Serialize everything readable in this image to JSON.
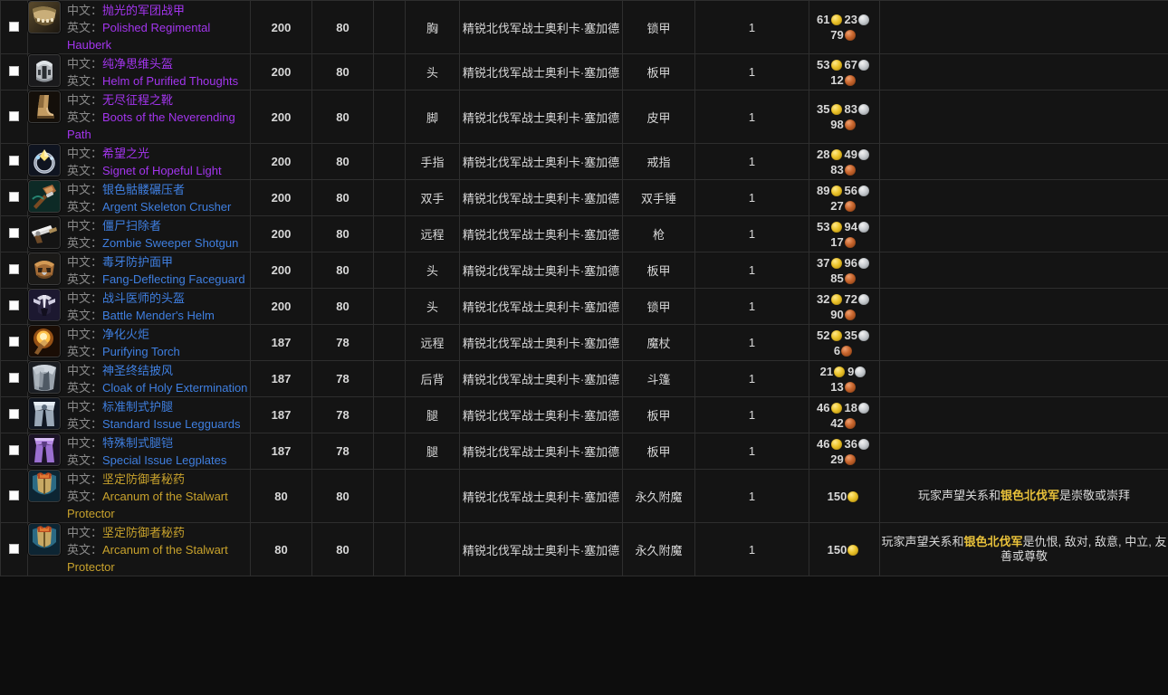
{
  "labels": {
    "cn_prefix": "中文：",
    "en_prefix": "英文："
  },
  "colors": {
    "epic": "#a335ee",
    "rare": "#3f7fe0",
    "uncommon": "#c8a22c",
    "faction_highlight": "#e8c13a",
    "background": "#141414",
    "border": "#2e2e2e"
  },
  "rows": [
    {
      "icon": "hauberk-icon",
      "quality": "epic",
      "name_cn": "抛光的军团战甲",
      "name_en": "Polished Regimental Hauberk",
      "ilvl": "200",
      "req_level": "80",
      "blank": "",
      "slot": "胸",
      "source": "精锐北伐军战士奥利卡·塞加德",
      "type": "锁甲",
      "qty": "1",
      "price": {
        "gold": "61",
        "silver": "23",
        "copper": "79"
      },
      "note": "",
      "note_faction": ""
    },
    {
      "icon": "helm-icon",
      "quality": "epic",
      "name_cn": "纯净思维头盔",
      "name_en": "Helm of Purified Thoughts",
      "ilvl": "200",
      "req_level": "80",
      "blank": "",
      "slot": "头",
      "source": "精锐北伐军战士奥利卡·塞加德",
      "type": "板甲",
      "qty": "1",
      "price": {
        "gold": "53",
        "silver": "67",
        "copper": "12"
      },
      "note": "",
      "note_faction": ""
    },
    {
      "icon": "boots-icon",
      "quality": "epic",
      "name_cn": "无尽征程之靴",
      "name_en": "Boots of the Neverending Path",
      "ilvl": "200",
      "req_level": "80",
      "blank": "",
      "slot": "脚",
      "source": "精锐北伐军战士奥利卡·塞加德",
      "type": "皮甲",
      "qty": "1",
      "price": {
        "gold": "35",
        "silver": "83",
        "copper": "98"
      },
      "note": "",
      "note_faction": ""
    },
    {
      "icon": "ring-icon",
      "quality": "epic",
      "name_cn": "希望之光",
      "name_en": "Signet of Hopeful Light",
      "ilvl": "200",
      "req_level": "80",
      "blank": "",
      "slot": "手指",
      "source": "精锐北伐军战士奥利卡·塞加德",
      "type": "戒指",
      "qty": "1",
      "price": {
        "gold": "28",
        "silver": "49",
        "copper": "83"
      },
      "note": "",
      "note_faction": ""
    },
    {
      "icon": "mace-icon",
      "quality": "rare",
      "name_cn": "银色骷髅碾压者",
      "name_en": "Argent Skeleton Crusher",
      "ilvl": "200",
      "req_level": "80",
      "blank": "",
      "slot": "双手",
      "source": "精锐北伐军战士奥利卡·塞加德",
      "type": "双手锤",
      "qty": "1",
      "price": {
        "gold": "89",
        "silver": "56",
        "copper": "27"
      },
      "note": "",
      "note_faction": ""
    },
    {
      "icon": "gun-icon",
      "quality": "rare",
      "name_cn": "僵尸扫除者",
      "name_en": "Zombie Sweeper Shotgun",
      "ilvl": "200",
      "req_level": "80",
      "blank": "",
      "slot": "远程",
      "source": "精锐北伐军战士奥利卡·塞加德",
      "type": "枪",
      "qty": "1",
      "price": {
        "gold": "53",
        "silver": "94",
        "copper": "17"
      },
      "note": "",
      "note_faction": ""
    },
    {
      "icon": "faceguard-icon",
      "quality": "rare",
      "name_cn": "毒牙防护面甲",
      "name_en": "Fang-Deflecting Faceguard",
      "ilvl": "200",
      "req_level": "80",
      "blank": "",
      "slot": "头",
      "source": "精锐北伐军战士奥利卡·塞加德",
      "type": "板甲",
      "qty": "1",
      "price": {
        "gold": "37",
        "silver": "96",
        "copper": "85"
      },
      "note": "",
      "note_faction": ""
    },
    {
      "icon": "mender-helm-icon",
      "quality": "rare",
      "name_cn": "战斗医师的头盔",
      "name_en": "Battle Mender's Helm",
      "ilvl": "200",
      "req_level": "80",
      "blank": "",
      "slot": "头",
      "source": "精锐北伐军战士奥利卡·塞加德",
      "type": "锁甲",
      "qty": "1",
      "price": {
        "gold": "32",
        "silver": "72",
        "copper": "90"
      },
      "note": "",
      "note_faction": ""
    },
    {
      "icon": "torch-icon",
      "quality": "rare",
      "name_cn": "净化火炬",
      "name_en": "Purifying Torch",
      "ilvl": "187",
      "req_level": "78",
      "blank": "",
      "slot": "远程",
      "source": "精锐北伐军战士奥利卡·塞加德",
      "type": "魔杖",
      "qty": "1",
      "price": {
        "gold": "52",
        "silver": "35",
        "copper": "6"
      },
      "note": "",
      "note_faction": ""
    },
    {
      "icon": "cloak-icon",
      "quality": "rare",
      "name_cn": "神圣终结披风",
      "name_en": "Cloak of Holy Extermination",
      "ilvl": "187",
      "req_level": "78",
      "blank": "",
      "slot": "后背",
      "source": "精锐北伐军战士奥利卡·塞加德",
      "type": "斗篷",
      "qty": "1",
      "price": {
        "gold": "21",
        "silver": "9",
        "copper": "13"
      },
      "note": "",
      "note_faction": ""
    },
    {
      "icon": "legguards-icon",
      "quality": "rare",
      "name_cn": "标准制式护腿",
      "name_en": "Standard Issue Legguards",
      "ilvl": "187",
      "req_level": "78",
      "blank": "",
      "slot": "腿",
      "source": "精锐北伐军战士奥利卡·塞加德",
      "type": "板甲",
      "qty": "1",
      "price": {
        "gold": "46",
        "silver": "18",
        "copper": "42"
      },
      "note": "",
      "note_faction": ""
    },
    {
      "icon": "legplates-icon",
      "quality": "rare",
      "name_cn": "特殊制式腿铠",
      "name_en": "Special Issue Legplates",
      "ilvl": "187",
      "req_level": "78",
      "blank": "",
      "slot": "腿",
      "source": "精锐北伐军战士奥利卡·塞加德",
      "type": "板甲",
      "qty": "1",
      "price": {
        "gold": "46",
        "silver": "36",
        "copper": "29"
      },
      "note": "",
      "note_faction": ""
    },
    {
      "icon": "arcanum-icon",
      "quality": "uncommon",
      "name_cn": "坚定防御者秘药",
      "name_en": "Arcanum of the Stalwart Protector",
      "ilvl": "80",
      "req_level": "80",
      "blank": "",
      "slot": "",
      "source": "精锐北伐军战士奥利卡·塞加德",
      "type": "永久附魔",
      "qty": "1",
      "price": {
        "gold": "150",
        "silver": "",
        "copper": ""
      },
      "note_pre": "玩家声望关系和",
      "note_faction": "银色北伐军",
      "note_post": "是崇敬或崇拜"
    },
    {
      "icon": "arcanum-icon",
      "quality": "uncommon",
      "name_cn": "坚定防御者秘药",
      "name_en": "Arcanum of the Stalwart Protector",
      "ilvl": "80",
      "req_level": "80",
      "blank": "",
      "slot": "",
      "source": "精锐北伐军战士奥利卡·塞加德",
      "type": "永久附魔",
      "qty": "1",
      "price": {
        "gold": "150",
        "silver": "",
        "copper": ""
      },
      "note_pre": "玩家声望关系和",
      "note_faction": "银色北伐军",
      "note_post": "是仇恨, 敌对, 敌意, 中立, 友善或尊敬"
    }
  ]
}
